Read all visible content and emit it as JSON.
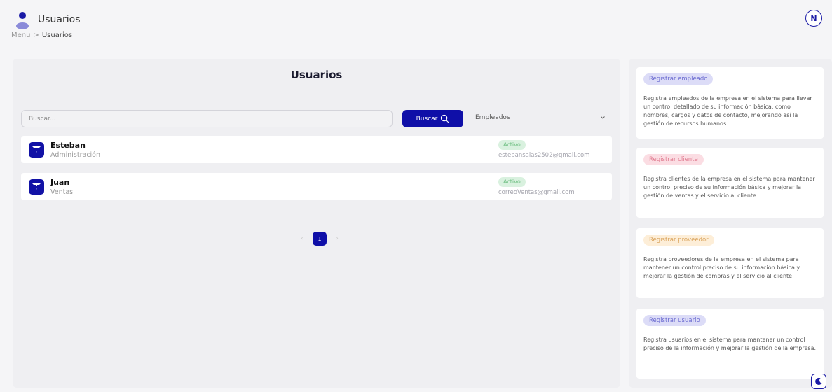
{
  "header": {
    "title": "Usuarios",
    "breadcrumb": {
      "root": "Menu",
      "separator": ">",
      "current": "Usuarios"
    },
    "avatar_initial": "N"
  },
  "main": {
    "title": "Usuarios",
    "search": {
      "placeholder": "Buscar...",
      "button_label": "Buscar"
    },
    "filter_select": {
      "selected": "Empleados"
    },
    "users": [
      {
        "name": "Esteban",
        "department": "Administración",
        "status": "Activo",
        "email": "estebansalas2502@gmail.com"
      },
      {
        "name": "Juan",
        "department": "Ventas",
        "status": "Activo",
        "email": "correoVentas@gmail.com"
      }
    ],
    "pagination": {
      "prev": "‹",
      "current_page": "1",
      "next": "›"
    }
  },
  "sidebar": {
    "cards": [
      {
        "tag": "Registrar empleado",
        "description": "Registra empleados de la empresa en el sistema para llevar un control detallado de su información básica, como nombres, cargos y datos de contacto, mejorando así la gestión de recursos humanos."
      },
      {
        "tag": "Registrar cliente",
        "description": "Registra clientes de la empresa en el sistema para mantener un control preciso de su información básica y mejorar la gestión de ventas y el servicio al cliente."
      },
      {
        "tag": "Registrar proveedor",
        "description": "Registra proveedores de la empresa en el sistema para mantener un control preciso de su información básica y mejorar la gestión de compras y el servicio al cliente."
      },
      {
        "tag": "Registrar usuario",
        "description": "Registra usuarios en el sistema para mantener un control preciso de la información y mejorar la gestión de la empresa."
      }
    ]
  },
  "colors": {
    "primary": "#0f0fa8",
    "tag_empleado_bg": "#dcdcf7",
    "tag_empleado_fg": "#6a6ad0",
    "tag_cliente_bg": "#fbdde3",
    "tag_cliente_fg": "#e07b90",
    "tag_proveedor_bg": "#fdeed8",
    "tag_proveedor_fg": "#d9a25a",
    "tag_usuario_bg": "#dcdcf7",
    "tag_usuario_fg": "#6a6ad0",
    "status_active_bg": "#d9f1df",
    "status_active_fg": "#6fbf82"
  },
  "icons": {
    "header": "user-icon",
    "avatar": "avatar-initial",
    "search": "search-icon",
    "select": "chevron-down-icon",
    "row_logo": "company-logo-icon",
    "theme": "moon-icon"
  }
}
